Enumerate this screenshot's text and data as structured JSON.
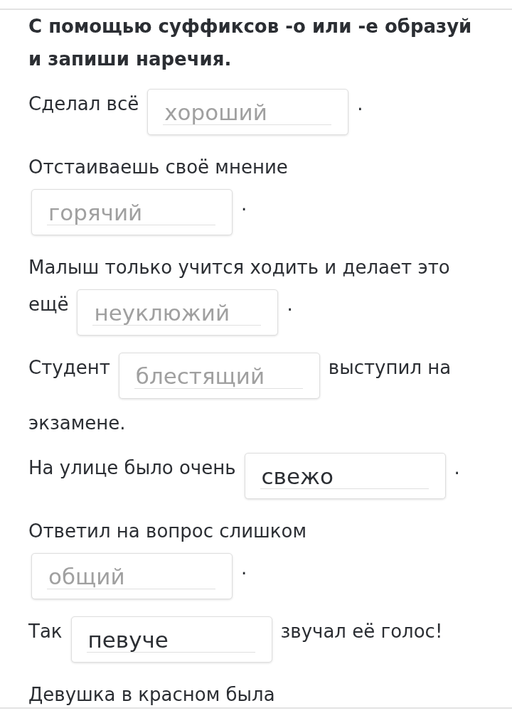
{
  "instruction": "С помощью суффиксов -о или -е образуй и запиши наречия.",
  "sentences": [
    {
      "parts": [
        {
          "kind": "text",
          "text": "Сделал всё"
        },
        {
          "kind": "blank",
          "placeholder": "хороший"
        },
        {
          "kind": "text",
          "text": "."
        }
      ]
    },
    {
      "parts": [
        {
          "kind": "text",
          "text": "Отстаиваешь своё мнение"
        },
        {
          "kind": "blank",
          "placeholder": "горячий"
        },
        {
          "kind": "text",
          "text": "."
        }
      ]
    },
    {
      "parts": [
        {
          "kind": "text",
          "text": "Малыш только учится ходить и делает это"
        },
        {
          "kind": "text",
          "text": "ещё"
        },
        {
          "kind": "blank",
          "placeholder": "неуклюжий"
        },
        {
          "kind": "text",
          "text": "."
        }
      ]
    },
    {
      "parts": [
        {
          "kind": "text",
          "text": "Студент"
        },
        {
          "kind": "blank",
          "placeholder": "блестящий"
        },
        {
          "kind": "text",
          "text": "выступил на"
        },
        {
          "kind": "text",
          "text": "экзамене."
        }
      ]
    },
    {
      "parts": [
        {
          "kind": "text",
          "text": "На улице было очень"
        },
        {
          "kind": "blank",
          "value": "свежо"
        },
        {
          "kind": "text",
          "text": "."
        }
      ]
    },
    {
      "parts": [
        {
          "kind": "text",
          "text": "Ответил на вопрос слишком"
        },
        {
          "kind": "blank",
          "placeholder": "общий"
        },
        {
          "kind": "text",
          "text": "."
        }
      ]
    },
    {
      "parts": [
        {
          "kind": "text",
          "text": "Так"
        },
        {
          "kind": "blank",
          "value": "певуче"
        },
        {
          "kind": "text",
          "text": "звучал её голос!"
        }
      ]
    },
    {
      "parts": [
        {
          "kind": "text",
          "text": "Девушка в красном была"
        }
      ]
    }
  ]
}
